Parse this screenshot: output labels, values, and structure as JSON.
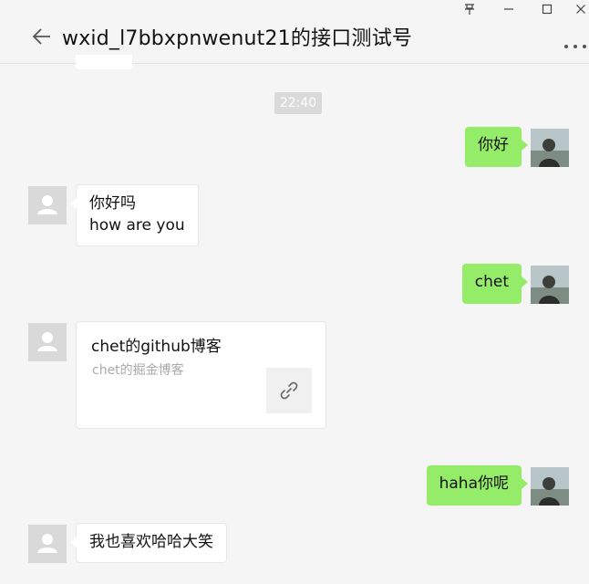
{
  "window": {
    "pin_icon": "pin-icon",
    "minimize_icon": "minimize-icon",
    "maximize_icon": "maximize-icon",
    "close_icon": "close-icon"
  },
  "header": {
    "title": "wxid_l7bbxpnwenut21的接口测试号",
    "back_icon": "arrow-left-icon",
    "more_icon": "more-dots-icon"
  },
  "colors": {
    "sent_bubble": "#95ec69",
    "received_bubble": "#ffffff",
    "background": "#f5f5f5",
    "timestamp_bg": "#dadada"
  },
  "chat": {
    "timestamp": "22:40",
    "messages": [
      {
        "direction": "sent",
        "lines": [
          "你好"
        ]
      },
      {
        "direction": "received",
        "lines": [
          "你好吗",
          "how are you"
        ]
      },
      {
        "direction": "sent",
        "lines": [
          "chet"
        ]
      },
      {
        "direction": "received",
        "type": "link",
        "title": "chet的github博客",
        "description": "chet的掘金博客",
        "thumb_icon": "link-icon"
      },
      {
        "direction": "sent",
        "lines": [
          "haha你呢"
        ]
      },
      {
        "direction": "received",
        "lines": [
          "我也喜欢哈哈大笑"
        ]
      }
    ]
  }
}
